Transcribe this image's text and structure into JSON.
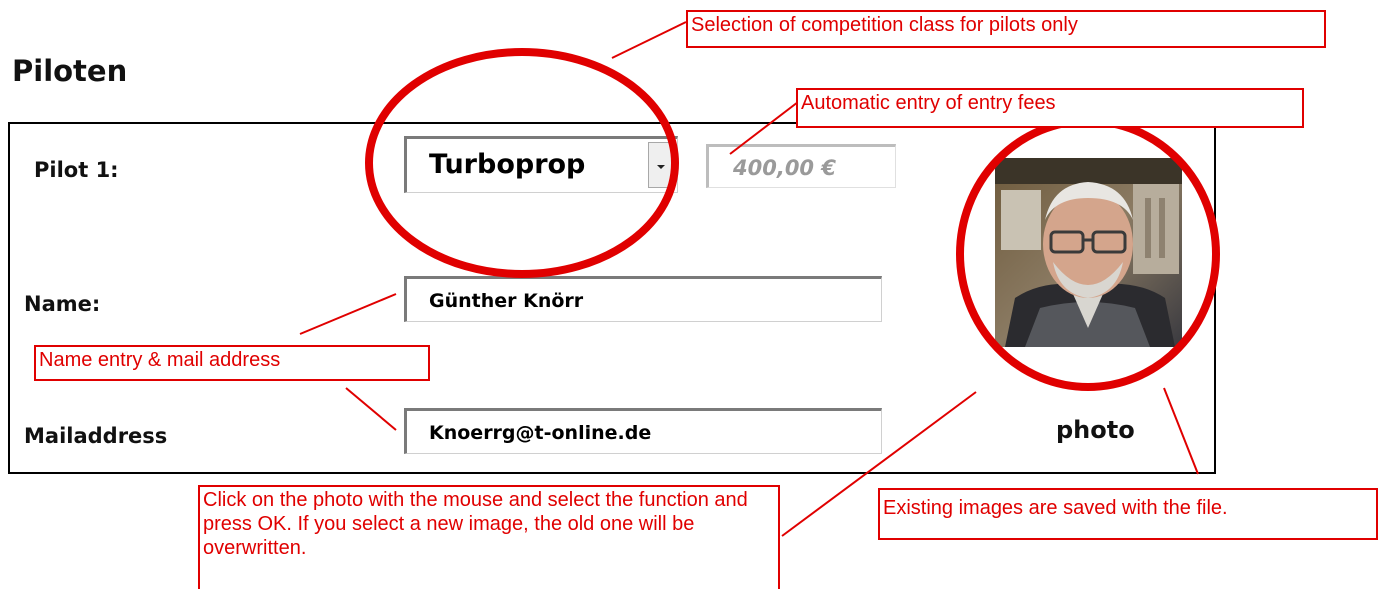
{
  "page": {
    "title": "Piloten"
  },
  "pilot": {
    "slot_label": "Pilot 1:",
    "class_value": "Turboprop",
    "fee_value": "400,00 €",
    "name_label": "Name:",
    "name_value": "Günther Knörr",
    "mail_label": "Mailaddress",
    "mail_value": "Knoerrg@t-online.de",
    "photo_label": "photo"
  },
  "annotations": {
    "class_note": "Selection of competition class for pilots only",
    "fee_note": "Automatic entry of entry fees",
    "name_note": "Name entry & mail address",
    "photo_note": "Click on the photo with the mouse and select the function and press OK. If you select a new image, the old one will be overwritten.",
    "saved_note": "Existing images are saved with the file."
  },
  "colors": {
    "annotation": "#e00000",
    "field_border": "#7a7a7a",
    "text": "#111111"
  }
}
